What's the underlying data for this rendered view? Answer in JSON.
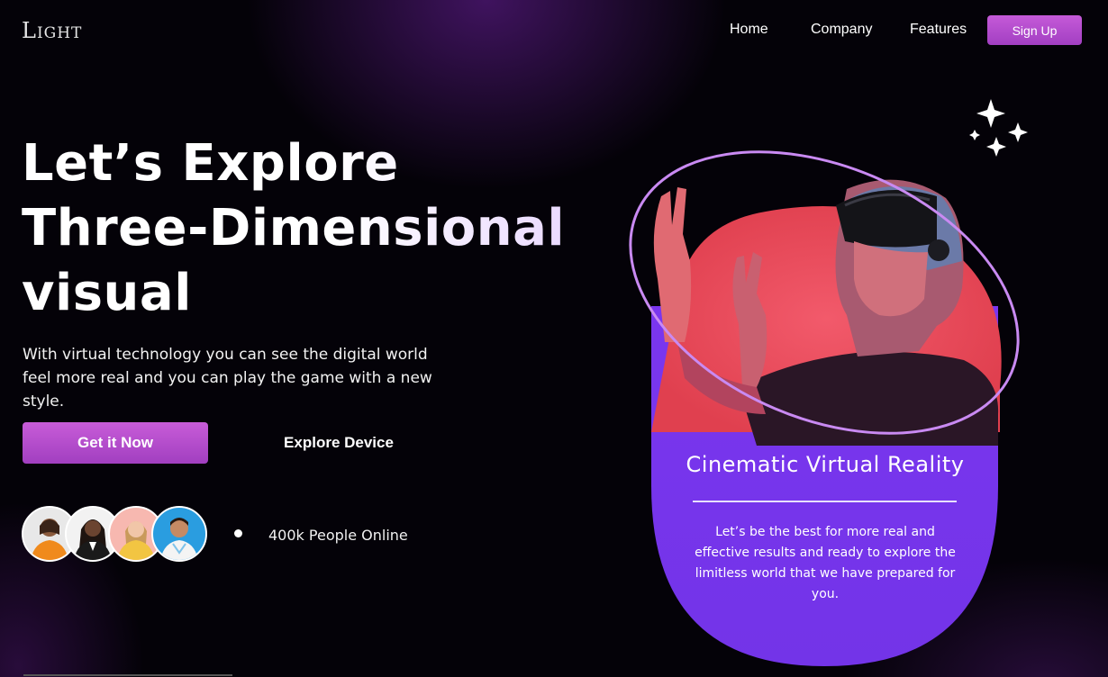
{
  "brand": {
    "logo_text": "LIGHT",
    "logo_first": "L",
    "logo_rest": "IGHT"
  },
  "nav": {
    "items": [
      {
        "label": "Home"
      },
      {
        "label": "Company"
      },
      {
        "label": "Features"
      }
    ],
    "signup_label": "Sign Up"
  },
  "hero": {
    "headline_lines": [
      "Let’s Explore",
      "Three-Dimensional",
      "visual"
    ],
    "subtitle": "With virtual technology you can see the digital world feel more real and you can play the game with a new style.",
    "primary_cta": "Get it Now",
    "secondary_cta": "Explore Device",
    "online_text": "400k People Online"
  },
  "avatars": [
    {
      "name": "avatar-1",
      "bg": "#e8e8e8",
      "shirt": "#f08a1c"
    },
    {
      "name": "avatar-2",
      "bg": "#f2f2f2",
      "shirt": "#1a1a1a"
    },
    {
      "name": "avatar-3",
      "bg": "#f7b8b0",
      "shirt": "#f2c542"
    },
    {
      "name": "avatar-4",
      "bg": "#2a9de0",
      "shirt": "#ffffff"
    }
  ],
  "card": {
    "title": "Cinematic Virtual Reality",
    "body": "Let’s be the best for more real and effective results and ready to explore the limitless world that we have prepared for you."
  },
  "icons": [
    "sparkle-icon",
    "vr-headset-image"
  ],
  "colors": {
    "background": "#040208",
    "accent_button": "#b44fce",
    "card_purple": "#7b3cf0",
    "card_red": "#ee4a5e",
    "ring": "#c88af0"
  }
}
